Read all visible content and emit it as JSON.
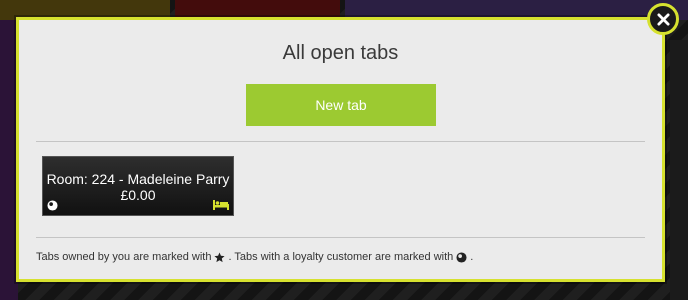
{
  "dialog": {
    "title": "All open tabs",
    "new_tab_label": "New tab",
    "tabs": [
      {
        "name": "Room: 224 - Madeleine Parry",
        "amount": "£0.00",
        "loyalty": true,
        "room": true
      }
    ],
    "footer": {
      "part1": "Tabs owned by you are marked with",
      "part2": ". Tabs with a loyalty customer are marked with",
      "part3": "."
    }
  },
  "colors": {
    "accent": "#d6e12f",
    "button_green": "#9cca31",
    "dialog_bg": "#ebebeb",
    "tab_bg": "#1a1a1a"
  },
  "icons": {
    "close": "close-icon",
    "loyalty": "loyalty-icon",
    "room": "bed-icon",
    "owned": "star-icon"
  }
}
